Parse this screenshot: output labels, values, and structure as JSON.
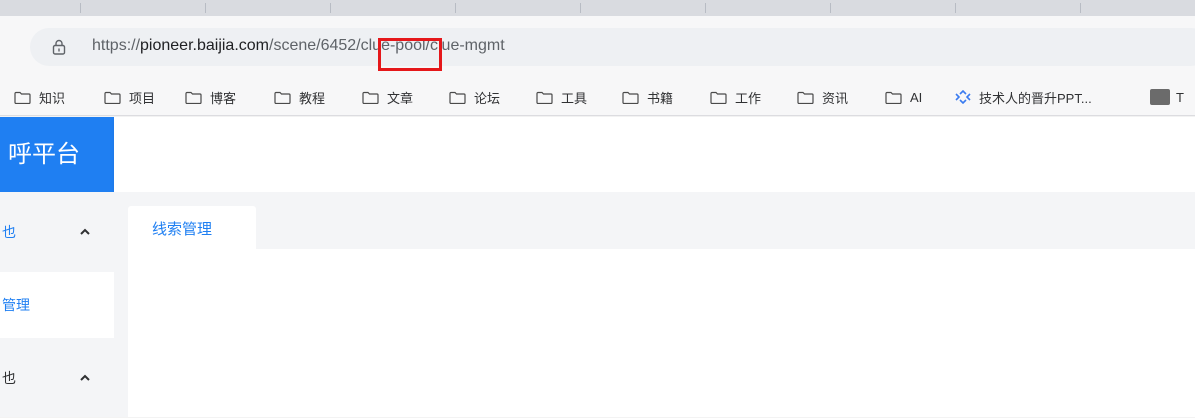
{
  "browser": {
    "url_prefix": "https://",
    "url_domain": "pioneer.baijia.com",
    "url_path_before": "/scene",
    "url_path_highlight": "/6452/",
    "url_path_after": "clue-pool/clue-mgmt"
  },
  "bookmarks": [
    {
      "label": "知识",
      "icon": "folder-icon"
    },
    {
      "label": "项目",
      "icon": "folder-icon"
    },
    {
      "label": "博客",
      "icon": "folder-icon"
    },
    {
      "label": "教程",
      "icon": "folder-icon"
    },
    {
      "label": "文章",
      "icon": "folder-icon"
    },
    {
      "label": "论坛",
      "icon": "folder-icon"
    },
    {
      "label": "工具",
      "icon": "folder-icon"
    },
    {
      "label": "书籍",
      "icon": "folder-icon"
    },
    {
      "label": "工作",
      "icon": "folder-icon"
    },
    {
      "label": "资讯",
      "icon": "folder-icon"
    },
    {
      "label": "AI",
      "icon": "folder-icon"
    },
    {
      "label": "技术人的晋升PPT...",
      "icon": "diamond-icon"
    },
    {
      "label": "T",
      "icon": "panda-icon"
    }
  ],
  "app": {
    "logo_text": "呼平台",
    "sidebar": {
      "group1_label": "也",
      "active_item_label": "管理",
      "group2_label": "也"
    },
    "tabs": [
      {
        "label": "线索管理"
      }
    ]
  },
  "colors": {
    "brand": "#1f7ff2",
    "highlight": "#e5171a"
  }
}
